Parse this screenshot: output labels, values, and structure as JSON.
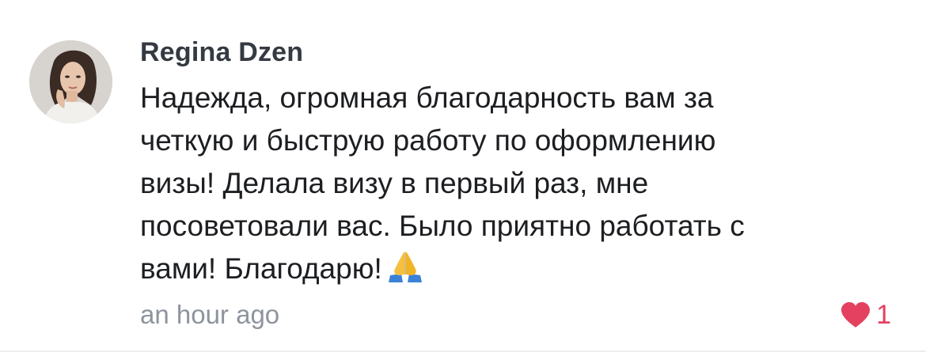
{
  "comment": {
    "author": "Regina Dzen",
    "text_lines": [
      "Надежда, огромная благодарность вам за",
      "четкую и быструю работу по оформлению",
      "визы! Делала визу в первый раз, мне",
      "посоветовали вас. Было приятно работать с",
      "вами! Благодарю!"
    ],
    "emoji": "folded-hands-emoji",
    "timestamp": "an hour ago",
    "like_count": "1",
    "like_icon": "heart-icon",
    "colors": {
      "author": "#353a42",
      "text": "#1c1e21",
      "timestamp": "#8d949e",
      "heart": "#e4405f"
    }
  }
}
